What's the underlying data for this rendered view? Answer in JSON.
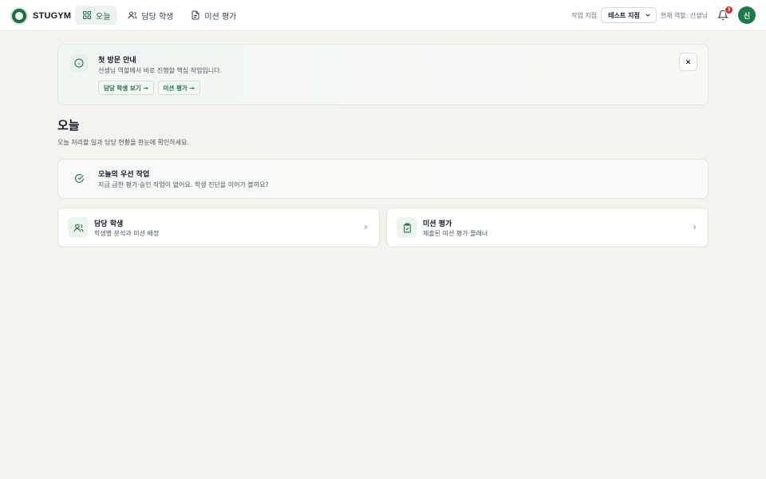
{
  "brand": {
    "name": "STUGYM"
  },
  "nav": {
    "items": [
      {
        "label": "오늘",
        "icon": "grid-icon",
        "active": true
      },
      {
        "label": "담당 학생",
        "icon": "users-icon",
        "active": false
      },
      {
        "label": "미션 평가",
        "icon": "document-icon",
        "active": false
      }
    ]
  },
  "header": {
    "branch_label": "작업 지점",
    "branch_value": "테스트 지점",
    "role_text": "현재 역할: 선생님",
    "notification_count": "3",
    "avatar_initial": "신"
  },
  "notice": {
    "title": "첫 방문 안내",
    "description": "선생님 역할에서 바로 진행할 핵심 작업입니다.",
    "actions": [
      "담당 학생 보기 →",
      "미션 평가 →"
    ]
  },
  "page": {
    "title": "오늘",
    "subtitle": "오늘 처리할 일과 담당 현황을 한눈에 확인하세요."
  },
  "priority": {
    "title": "오늘의 우선 작업",
    "description": "지금 급한 평가·승인 작업이 없어요. 학생 진단을 이어가 볼까요?"
  },
  "cards": [
    {
      "title": "담당 학생",
      "description": "학생별 분석과 미션 배정",
      "icon": "users-icon"
    },
    {
      "title": "미션 평가",
      "description": "제출된 미션 평가·플래너",
      "icon": "clipboard-check-icon"
    }
  ],
  "colors": {
    "brand_green": "#1f6b45",
    "avatar_green": "#1f7a4a",
    "badge_red": "#dc2626",
    "background": "#f4f3ef"
  }
}
